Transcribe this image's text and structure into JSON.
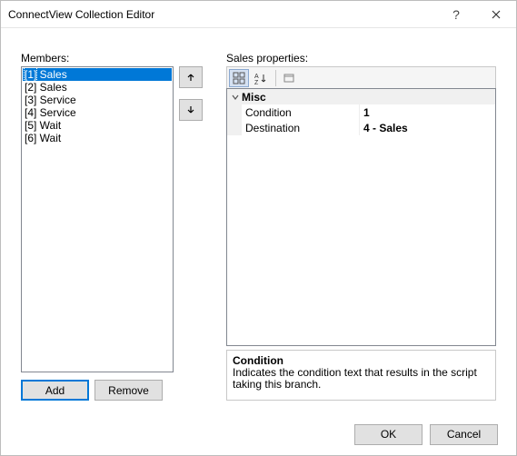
{
  "window": {
    "title": "ConnectView Collection Editor"
  },
  "labels": {
    "members": "Members:",
    "properties_prefix": "Sales",
    "properties_suffix": " properties:"
  },
  "members": [
    {
      "index": "[1]",
      "name": "Sales",
      "selected": true
    },
    {
      "index": "[2]",
      "name": "Sales",
      "selected": false
    },
    {
      "index": "[3]",
      "name": "Service",
      "selected": false
    },
    {
      "index": "[4]",
      "name": "Service",
      "selected": false
    },
    {
      "index": "[5]",
      "name": "Wait",
      "selected": false
    },
    {
      "index": "[6]",
      "name": "Wait",
      "selected": false
    }
  ],
  "buttons": {
    "add": "Add",
    "remove": "Remove",
    "ok": "OK",
    "cancel": "Cancel"
  },
  "propgrid": {
    "category": "Misc",
    "rows": [
      {
        "name": "Condition",
        "value": "1"
      },
      {
        "name": "Destination",
        "value": "4 - Sales"
      }
    ],
    "desc_title": "Condition",
    "desc_text": "Indicates the condition text that results in the script taking this branch."
  }
}
